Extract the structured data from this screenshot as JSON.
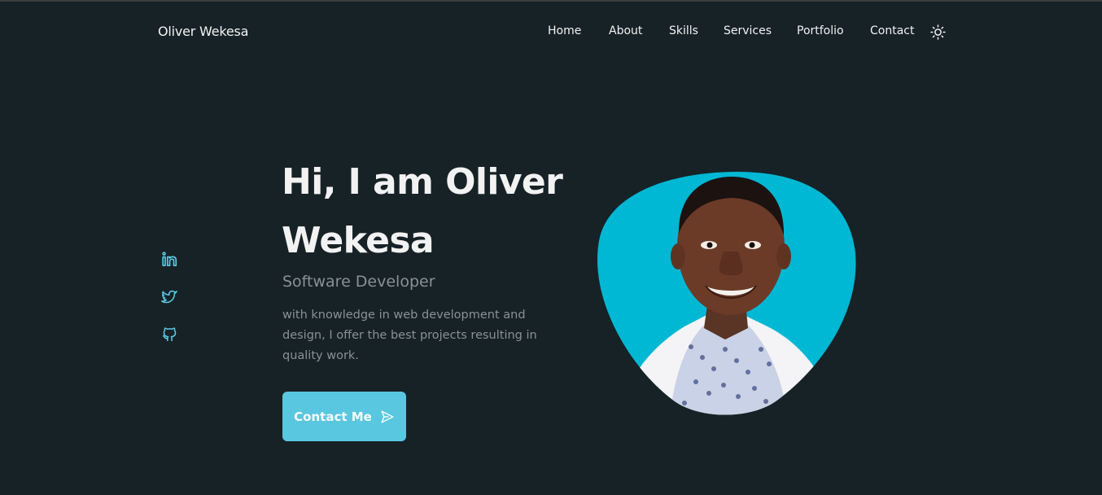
{
  "header": {
    "brand": "Oliver Wekesa",
    "nav": {
      "home": "Home",
      "about": "About",
      "skills": "Skills",
      "services": "Services",
      "portfolio": "Portfolio",
      "contact": "Contact"
    },
    "theme_toggle_icon": "sun-icon"
  },
  "social": {
    "icons": [
      "linkedin-icon",
      "twitter-icon",
      "github-icon"
    ],
    "color": "#59c7e0"
  },
  "hero": {
    "title": "Hi, I am Oliver Wekesa",
    "subtitle": "Software Developer",
    "description": "with knowledge in web development and design, I offer the best projects resulting in quality work.",
    "button_label": "Contact Me",
    "button_icon": "send-icon"
  },
  "profile": {
    "image_icon": "profile-photo",
    "blob_color": "#00b8d4"
  },
  "colors": {
    "background": "#172226",
    "text": "#f2f2f2",
    "muted_text": "#8a9194",
    "accent": "#59c7e0"
  }
}
